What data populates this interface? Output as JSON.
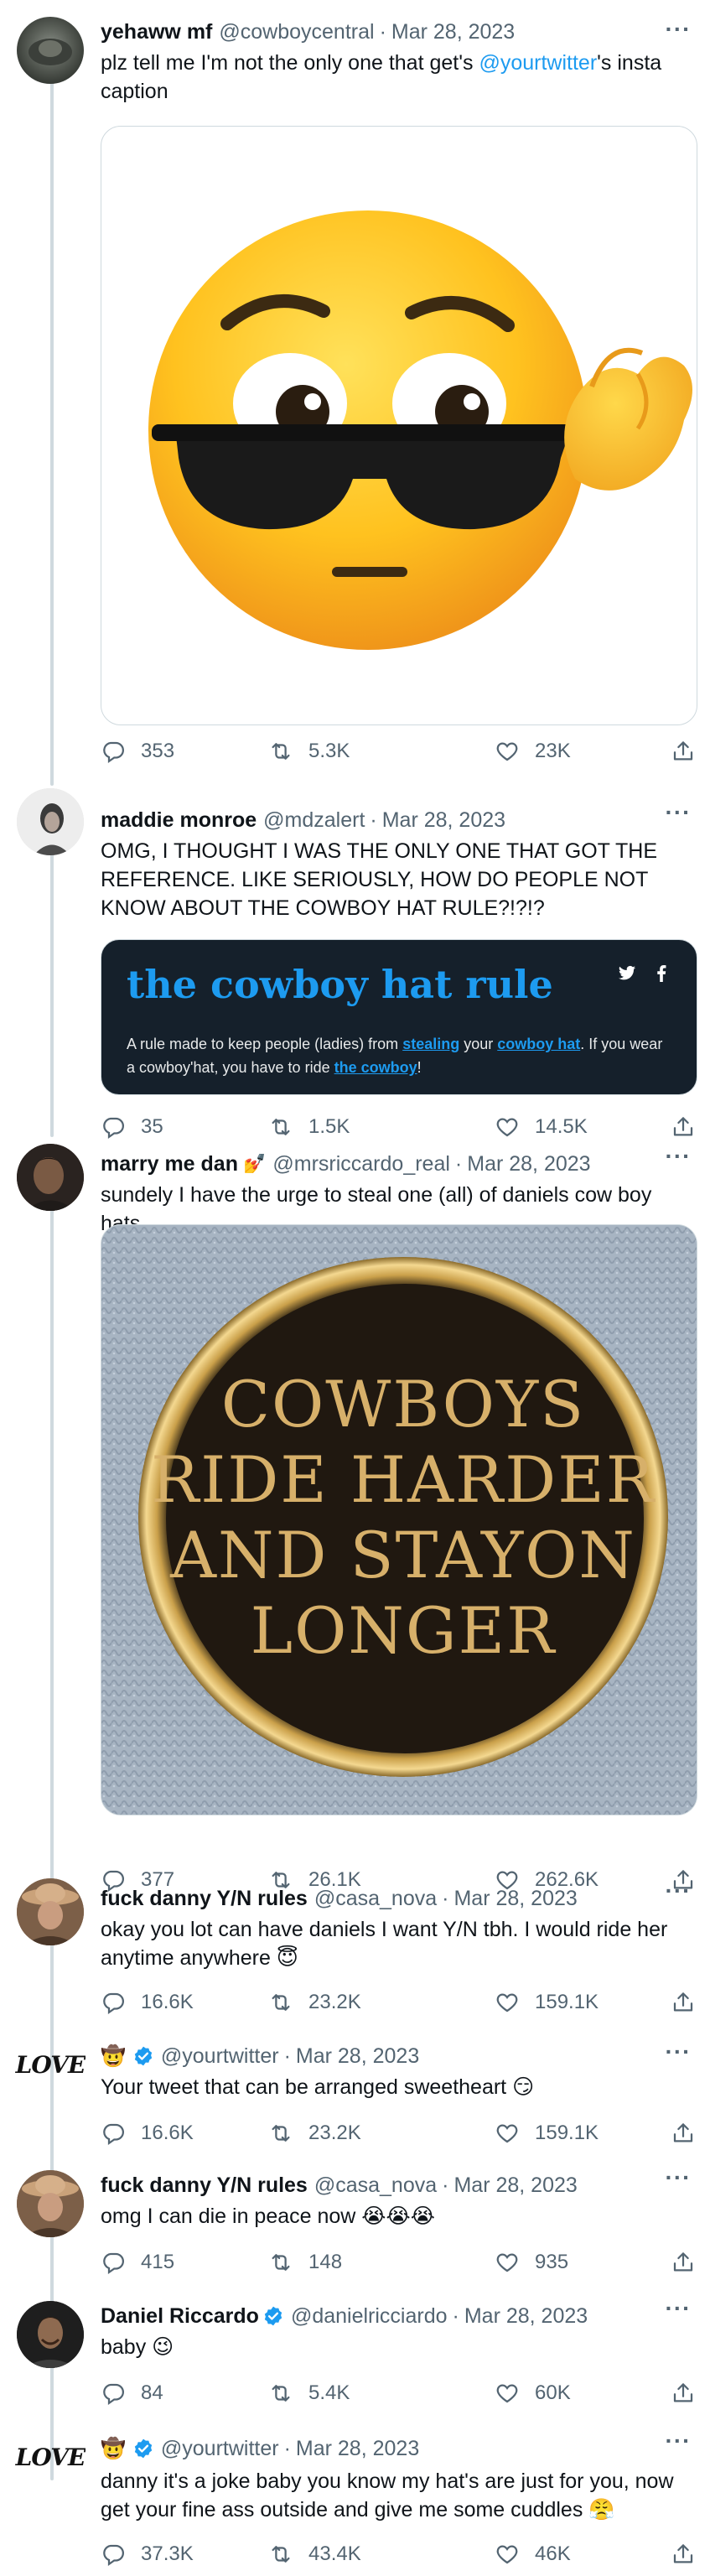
{
  "colors": {
    "accent": "#1d9bf0",
    "muted": "#536471",
    "line": "#cfd9de",
    "card_bg": "#15202b"
  },
  "tweets": [
    {
      "name": "yehaww mf",
      "handle": "@cowboycentral",
      "date": "Mar 28, 2023",
      "text_before": "plz tell me I'm not the only one that get's ",
      "mention": "@yourtwitter",
      "text_after": "'s insta caption",
      "media_icon": "sunglasses-ok-emoji-image",
      "replies": "353",
      "retweets": "5.3K",
      "likes": "23K"
    },
    {
      "name": "maddie monroe",
      "handle": "@mdzalert",
      "date": "Mar 28, 2023",
      "text": "OMG, I THOUGHT I WAS THE ONLY ONE THAT GOT THE REFERENCE. LIKE SERIOUSLY, HOW DO PEOPLE NOT KNOW ABOUT THE COWBOY HAT RULE?!?!?",
      "card": {
        "title": "the cowboy hat rule",
        "share_icons": [
          "twitter-icon",
          "facebook-icon"
        ],
        "desc_1": "A rule made to keep people (ladies) from ",
        "link_1": "stealing",
        "desc_2": " your ",
        "link_2": "cowboy hat",
        "desc_3": ". If you wear a cowboy'hat, you have to ride ",
        "link_3": "the cowboy",
        "desc_4": "!"
      },
      "replies": "35",
      "retweets": "1.5K",
      "likes": "14.5K"
    },
    {
      "name": "marry me dan",
      "name_emoji": "💅",
      "handle": "@mrsriccardo_real",
      "date": "Mar 28, 2023",
      "text": "sundely I have the urge to steal one (all) of daniels cow boy hats",
      "pin_lines": [
        "COWBOYS",
        "RIDE HARDER",
        "AND STAYON",
        "LONGER"
      ],
      "replies": "377",
      "retweets": "26.1K",
      "likes": "262.6K"
    },
    {
      "name": "fuck danny Y/N rules",
      "handle": "@casa_nova",
      "date": "Mar 28, 2023",
      "text": "okay you lot can have daniels I want Y/N tbh. I would ride her anytime anywhere 😇",
      "replies": "16.6K",
      "retweets": "23.2K",
      "likes": "159.1K"
    },
    {
      "name_emoji": "🤠",
      "handle": "@yourtwitter",
      "date": "Mar 28, 2023",
      "text": "Your tweet that can be arranged sweetheart 😏",
      "replies": "16.6K",
      "retweets": "23.2K",
      "likes": "159.1K"
    },
    {
      "name": "fuck danny Y/N rules",
      "handle": "@casa_nova",
      "date": "Mar 28, 2023",
      "text": "omg I can die in peace now 😭😭😭",
      "replies": "415",
      "retweets": "148",
      "likes": "935"
    },
    {
      "name": "Daniel Riccardo",
      "handle": "@danielricciardo",
      "date": "Mar 28, 2023",
      "text": "baby 😉",
      "replies": "84",
      "retweets": "5.4K",
      "likes": "60K"
    },
    {
      "name_emoji": "🤠",
      "handle": "@yourtwitter",
      "date": "Mar 28, 2023",
      "text": "danny it's a joke baby you know my hat's are just for you, now get your fine ass outside and give me some cuddles 😤",
      "replies": "37.3K",
      "retweets": "43.4K",
      "likes": "46K"
    }
  ],
  "logo_text": "LOVE",
  "more_label": "···",
  "dot": "·"
}
